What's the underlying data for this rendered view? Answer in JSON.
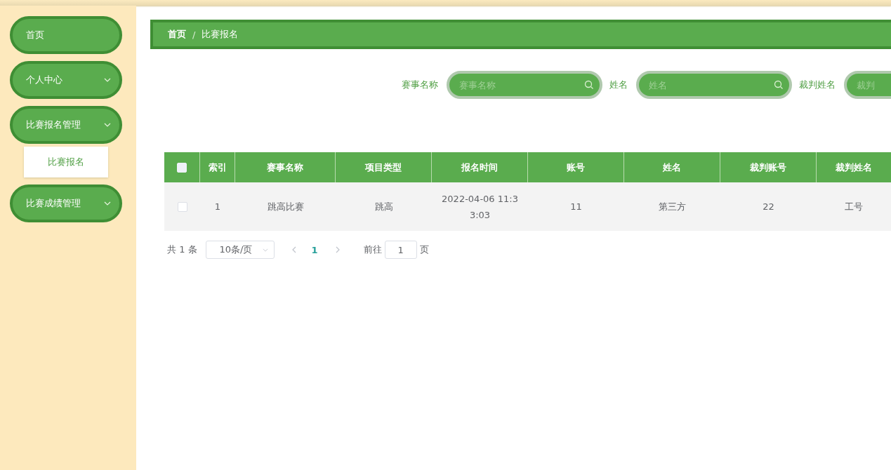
{
  "sidebar": {
    "items": [
      {
        "label": "首页",
        "kind": "link"
      },
      {
        "label": "个人中心",
        "kind": "group"
      },
      {
        "label": "比赛报名管理",
        "kind": "group",
        "children": [
          {
            "label": "比赛报名",
            "selected": true
          }
        ]
      },
      {
        "label": "比赛成绩管理",
        "kind": "group"
      }
    ]
  },
  "breadcrumb": [
    "首页",
    "比赛报名"
  ],
  "breadcrumb_separator": "/",
  "search": [
    {
      "label": "赛事名称",
      "placeholder": "赛事名称"
    },
    {
      "label": "姓名",
      "placeholder": "姓名"
    },
    {
      "label": "裁判姓名",
      "placeholder": "裁判"
    }
  ],
  "table": {
    "all_checked": false,
    "columns": [
      "索引",
      "赛事名称",
      "项目类型",
      "报名时间",
      "账号",
      "姓名",
      "裁判账号",
      "裁判姓名"
    ],
    "rows": [
      {
        "checked": false,
        "cells": [
          "1",
          "跳高比赛",
          "跳高",
          "2022-04-06 11:33:03",
          "11",
          "第三方",
          "22",
          "工号"
        ]
      }
    ]
  },
  "pagination": {
    "total": "共 1 条",
    "page_size": "10条/页",
    "pages": [
      {
        "label": "1",
        "selected": true
      }
    ],
    "goto_label": "前往",
    "goto_value": "1",
    "page_label": "页"
  }
}
